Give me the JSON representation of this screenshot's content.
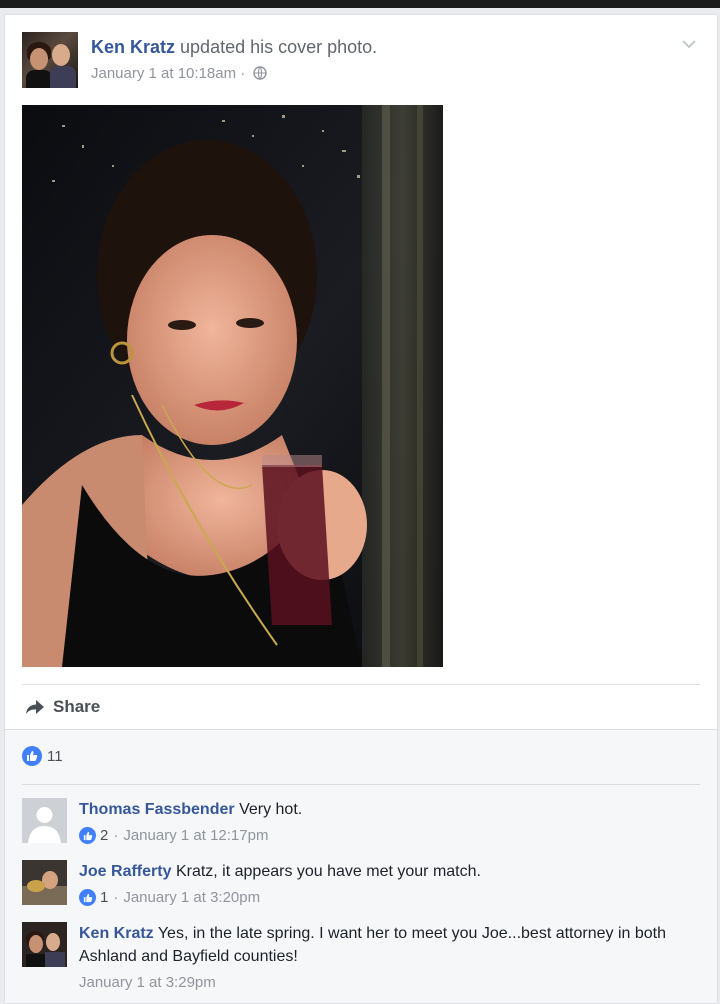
{
  "post": {
    "author": "Ken Kratz",
    "action": "updated his cover photo.",
    "timestamp": "January 1 at 10:18am",
    "separator": "·",
    "privacy_icon": "globe-icon",
    "menu_icon": "chevron-down-icon"
  },
  "actions": {
    "share_label": "Share",
    "share_icon": "share-arrow-icon"
  },
  "reactions": {
    "like_icon": "thumbs-up-icon",
    "count": "11"
  },
  "comments": [
    {
      "author": "Thomas Fassbender",
      "text": "Very hot.",
      "likes": "2",
      "sep": "·",
      "timestamp": "January 1 at 12:17pm"
    },
    {
      "author": "Joe Rafferty",
      "text": "Kratz, it appears you have met your match.",
      "likes": "1",
      "sep": "·",
      "timestamp": "January 1 at 3:20pm"
    },
    {
      "author": "Ken Kratz",
      "text": "Yes, in the late spring. I want her to meet you Joe...best attorney in both Ashland and Bayfield counties!",
      "timestamp": "January 1 at 3:29pm"
    }
  ],
  "colors": {
    "link_blue": "#365899",
    "like_blue": "#4080ff",
    "meta_gray": "#90949c",
    "background": "#e9ebee"
  }
}
